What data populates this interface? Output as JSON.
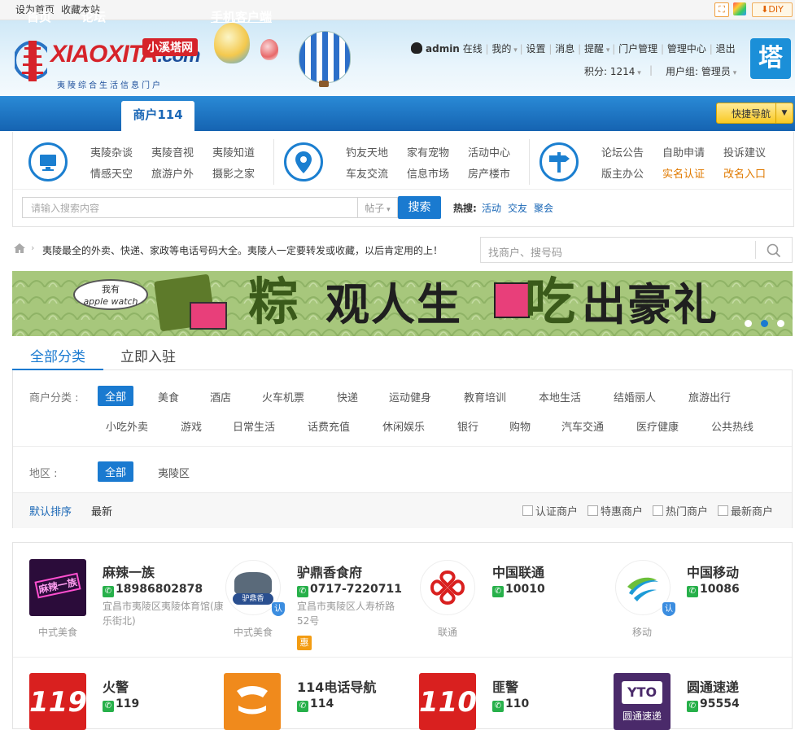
{
  "topbar": {
    "set_home": "设为首页",
    "bookmark": "收藏本站",
    "diy": "DIY"
  },
  "header": {
    "logo_badge": "小溪塔网",
    "logo_main": "XIAOXITA",
    "logo_domain": ".com",
    "logo_slogan": "夷陵综合生活信息门户",
    "username": "admin",
    "online": "在线",
    "links": [
      "我的",
      "设置",
      "消息",
      "提醒",
      "门户管理",
      "管理中心",
      "退出"
    ],
    "points_label": "积分: 1214",
    "group_label": "用户组: 管理员",
    "tower_glyph": "塔"
  },
  "nav": {
    "items": [
      "首页",
      "论坛",
      "商户114",
      "手机客户端"
    ],
    "quick_nav": "快捷导航"
  },
  "categories": {
    "group1": [
      "夷陵杂谈",
      "夷陵音视",
      "夷陵知道",
      "情感天空",
      "旅游户外",
      "摄影之家"
    ],
    "group2": [
      "钓友天地",
      "家有宠物",
      "活动中心",
      "车友交流",
      "信息市场",
      "房产楼市"
    ],
    "group3": [
      "论坛公告",
      "自助申请",
      "投诉建议",
      "版主办公",
      "实名认证",
      "改名入口"
    ]
  },
  "search": {
    "placeholder": "请输入搜索内容",
    "type": "帖子",
    "button": "搜索",
    "hot_label": "热搜:",
    "hot_items": [
      "活动",
      "交友",
      "聚会"
    ]
  },
  "breadcrumb": {
    "text": "夷陵最全的外卖、快递、家政等电话号码大全。夷陵人一定要转发或收藏，以后肯定用的上！",
    "shop_search_placeholder": "找商户、搜号码"
  },
  "banner": {
    "bubble_line1": "我有",
    "bubble_line2": "apple watch",
    "text1": "粽",
    "text2": "观人生",
    "text3": "吃",
    "text4": "出豪礼"
  },
  "tabs": [
    "全部分类",
    "立即入驻"
  ],
  "filter": {
    "category_label": "商户分类 :",
    "category_row1": [
      "全部",
      "美食",
      "酒店",
      "火车机票",
      "快递",
      "运动健身",
      "教育培训",
      "本地生活",
      "结婚丽人",
      "旅游出行"
    ],
    "category_row2": [
      "小吃外卖",
      "游戏",
      "日常生活",
      "话费充值",
      "休闲娱乐",
      "银行",
      "购物",
      "汽车交通",
      "医疗健康",
      "公共热线"
    ],
    "area_label": "地区 :",
    "areas": [
      "全部",
      "夷陵区"
    ],
    "sort": [
      "默认排序",
      "最新"
    ],
    "checks": [
      "认证商户",
      "特惠商户",
      "热门商户",
      "最新商户"
    ]
  },
  "merchants": [
    {
      "name": "麻辣一族",
      "phone": "18986802878",
      "address": "宜昌市夷陵区夷陵体育馆(康乐街北)",
      "category": "中式美食",
      "thumb_text": "麻辣一族",
      "verified": false
    },
    {
      "name": "驴鼎香食府",
      "phone": "0717-7220711",
      "address": "宜昌市夷陵区人寿桥路52号",
      "category": "中式美食",
      "thumb_text": "驴鼎香",
      "verified": true,
      "badge": "惠"
    },
    {
      "name": "中国联通",
      "phone": "10010",
      "address": "",
      "category": "联通",
      "verified": false
    },
    {
      "name": "中国移动",
      "phone": "10086",
      "address": "",
      "category": "移动",
      "verified": true
    },
    {
      "name": "火警",
      "phone": "119",
      "thumb_text": "119"
    },
    {
      "name": "114电话导航",
      "phone": "114"
    },
    {
      "name": "匪警",
      "phone": "110",
      "thumb_text": "110"
    },
    {
      "name": "圆通速递",
      "phone": "95554",
      "thumb_text": "圆通速递"
    }
  ],
  "verify_badge": "认"
}
